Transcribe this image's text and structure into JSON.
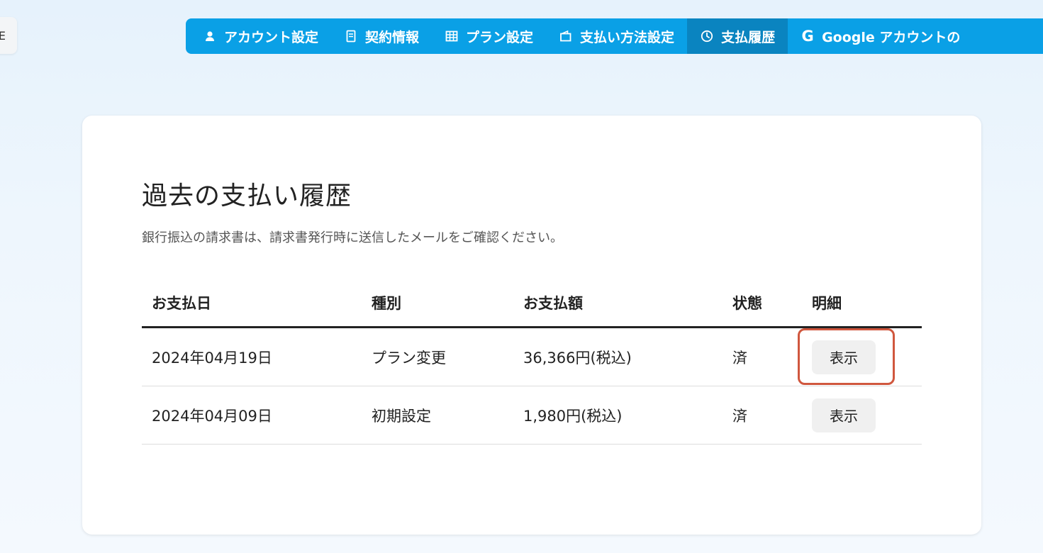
{
  "side_tab": {
    "label": "E"
  },
  "nav": {
    "items": [
      {
        "label": "アカウント設定",
        "icon": "person-icon",
        "active": false
      },
      {
        "label": "契約情報",
        "icon": "document-icon",
        "active": false
      },
      {
        "label": "プラン設定",
        "icon": "grid-icon",
        "active": false
      },
      {
        "label": "支払い方法設定",
        "icon": "wallet-icon",
        "active": false
      },
      {
        "label": "支払履歴",
        "icon": "clock-icon",
        "active": true
      },
      {
        "label": "Google アカウントの",
        "icon": "google-icon",
        "active": false
      }
    ],
    "google_glyph": "G",
    "colors": {
      "background": "#0aa0e6",
      "active": "#0a84c0"
    }
  },
  "main": {
    "title": "過去の支払い履歴",
    "subtitle": "銀行振込の請求書は、請求書発行時に送信したメールをご確認ください。",
    "table": {
      "headers": [
        "お支払日",
        "種別",
        "お支払額",
        "状態",
        "明細"
      ],
      "rows": [
        {
          "date": "2024年04月19日",
          "type": "プラン変更",
          "amount": "36,366円(税込)",
          "status": "済",
          "action": "表示"
        },
        {
          "date": "2024年04月09日",
          "type": "初期設定",
          "amount": "1,980円(税込)",
          "status": "済",
          "action": "表示"
        }
      ]
    }
  },
  "highlight_color": "#d0573e"
}
